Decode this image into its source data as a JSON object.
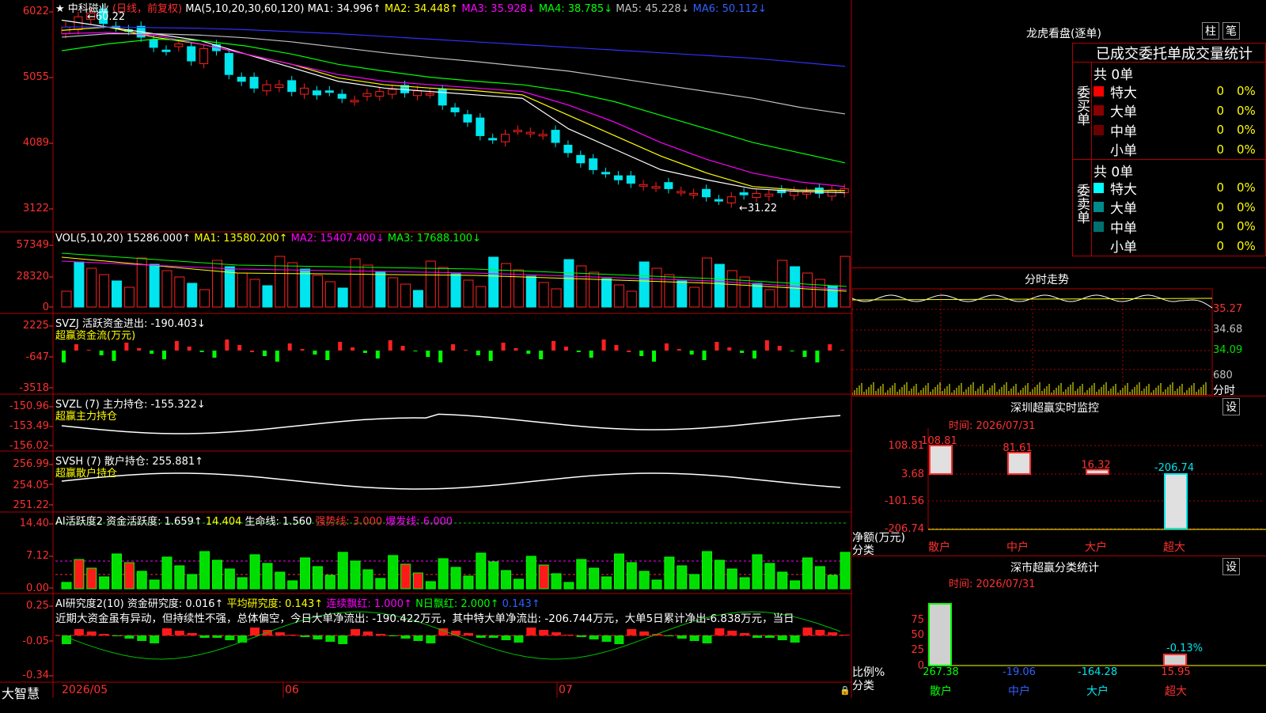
{
  "stock": {
    "name": "中科磁业",
    "mode": "(日线，前复权)",
    "ma_prefix": "MA(5,10,20,30,60,120)",
    "ma1": "MA1: 34.996↑",
    "ma2": "MA2: 34.448↑",
    "ma3": "MA3: 35.928↓",
    "ma4": "MA4: 38.785↓",
    "ma5": "MA5: 45.228↓",
    "ma6": "MA6: 50.112↓",
    "high_label": "←60.22",
    "low_label": "←31.22",
    "price_ticks": [
      "6022",
      "5055",
      "4089",
      "3122"
    ]
  },
  "vol": {
    "prefix": "VOL(5,10,20)",
    "value": "15286.000↑",
    "ma1": "MA1: 13580.200↑",
    "ma2": "MA2: 15407.400↓",
    "ma3": "MA3: 17688.100↓",
    "ticks": [
      "57349",
      "28320",
      "0"
    ]
  },
  "svzj": {
    "line1": "SVZJ  活跃资金进出: -190.403↓",
    "line2": "超赢资金流(万元)",
    "ticks": [
      "2225",
      "-647",
      "-3518"
    ]
  },
  "svzl": {
    "line1": "SVZL (7) 主力持仓: -155.322↓",
    "line2": "超赢主力持仓",
    "ticks": [
      "-150.96",
      "-153.49",
      "-156.02"
    ]
  },
  "svsh": {
    "line1": "SVSH (7) 散户持仓: 255.881↑",
    "line2": "超赢散户持仓",
    "ticks": [
      "256.99",
      "254.05",
      "251.22"
    ]
  },
  "ai_active": {
    "l1": "AI活跃度2 资金活跃度: 1.659↑",
    "l2": "14.404",
    "l3": "生命线: 1.560",
    "l4": "强势线: 3.000",
    "l5": "爆发线: 6.000",
    "ticks": [
      "14.40",
      "7.12",
      "0.00"
    ]
  },
  "ai_research": {
    "l1": "AI研究度2(10) 资金研究度: 0.016↑",
    "l2": "平均研究度: 0.143↑",
    "l3": "连续飘红: 1.000↑",
    "l4": "N日飘红: 2.000↑",
    "l5": "0.143↑",
    "commentary": "近期大资金虽有异动，但持续性不强，总体偏空，今日大单净流出: -190.422万元，其中特大单净流出: -206.744万元，大单5日累计净出-6.838万元，当日",
    "ticks": [
      "0.25",
      "-0.05",
      "-0.34"
    ]
  },
  "bottom": {
    "brand": "大智慧",
    "dates": [
      "2026/05",
      "06",
      "07"
    ]
  },
  "dragon": {
    "title": "龙虎看盘(逐单)",
    "btn_col": "柱",
    "btn_pen": "笔",
    "subtitle": "已成交委托单成交量统计",
    "buy_label": "委买单",
    "sell_label": "委卖单",
    "buy_total": "共 0单",
    "sell_total": "共 0单",
    "rows": [
      {
        "name": "特大",
        "val": "0",
        "pct": "0%"
      },
      {
        "name": "大单",
        "val": "0",
        "pct": "0%"
      },
      {
        "name": "中单",
        "val": "0",
        "pct": "0%"
      },
      {
        "name": "小单",
        "val": "0",
        "pct": "0%"
      }
    ],
    "sell_rows": [
      {
        "name": "特大",
        "val": "0",
        "pct": "0%"
      },
      {
        "name": "大单",
        "val": "0",
        "pct": "0%"
      },
      {
        "name": "中单",
        "val": "0",
        "pct": "0%"
      },
      {
        "name": "小单",
        "val": "0",
        "pct": "0%"
      }
    ]
  },
  "intraday": {
    "title": "分时走势",
    "ticks": [
      "35.27",
      "34.68",
      "34.09"
    ],
    "vol_tick": "680",
    "vol_label": "分时"
  },
  "sz_monitor": {
    "title": "深圳超赢实时监控",
    "btn": "设",
    "time": "时间: 2026/07/31",
    "y_ticks": [
      "108.81",
      "3.68",
      "-101.56",
      "-206.74"
    ],
    "net_label": "净额(万元)",
    "class_label": "分类",
    "bars": [
      {
        "cat": "散户",
        "value": 108.81,
        "label": "108.81"
      },
      {
        "cat": "中户",
        "value": 81.61,
        "label": "81.61"
      },
      {
        "cat": "大户",
        "value": 16.32,
        "label": "16.32"
      },
      {
        "cat": "超大",
        "value": -206.74,
        "label": "-206.74"
      }
    ]
  },
  "sz_class": {
    "title": "深市超赢分类统计",
    "btn": "设",
    "time": "时间: 2026/07/31",
    "y_ticks": [
      "75",
      "50",
      "25",
      "0"
    ],
    "ratio_label": "比例%",
    "class_label": "分类",
    "annotation": "-0.13%",
    "items": [
      {
        "cat": "散户",
        "value": "267.38"
      },
      {
        "cat": "中户",
        "value": "-19.06"
      },
      {
        "cat": "大户",
        "value": "-164.28"
      },
      {
        "cat": "超大",
        "value": "15.95"
      }
    ]
  },
  "colors": {
    "up": "#ff2020",
    "down": "#00e5ee",
    "green": "#00ff00",
    "yellow": "#ffff00",
    "magenta": "#ff00ff",
    "blue": "#0000ff",
    "grid": "#b00000"
  }
}
